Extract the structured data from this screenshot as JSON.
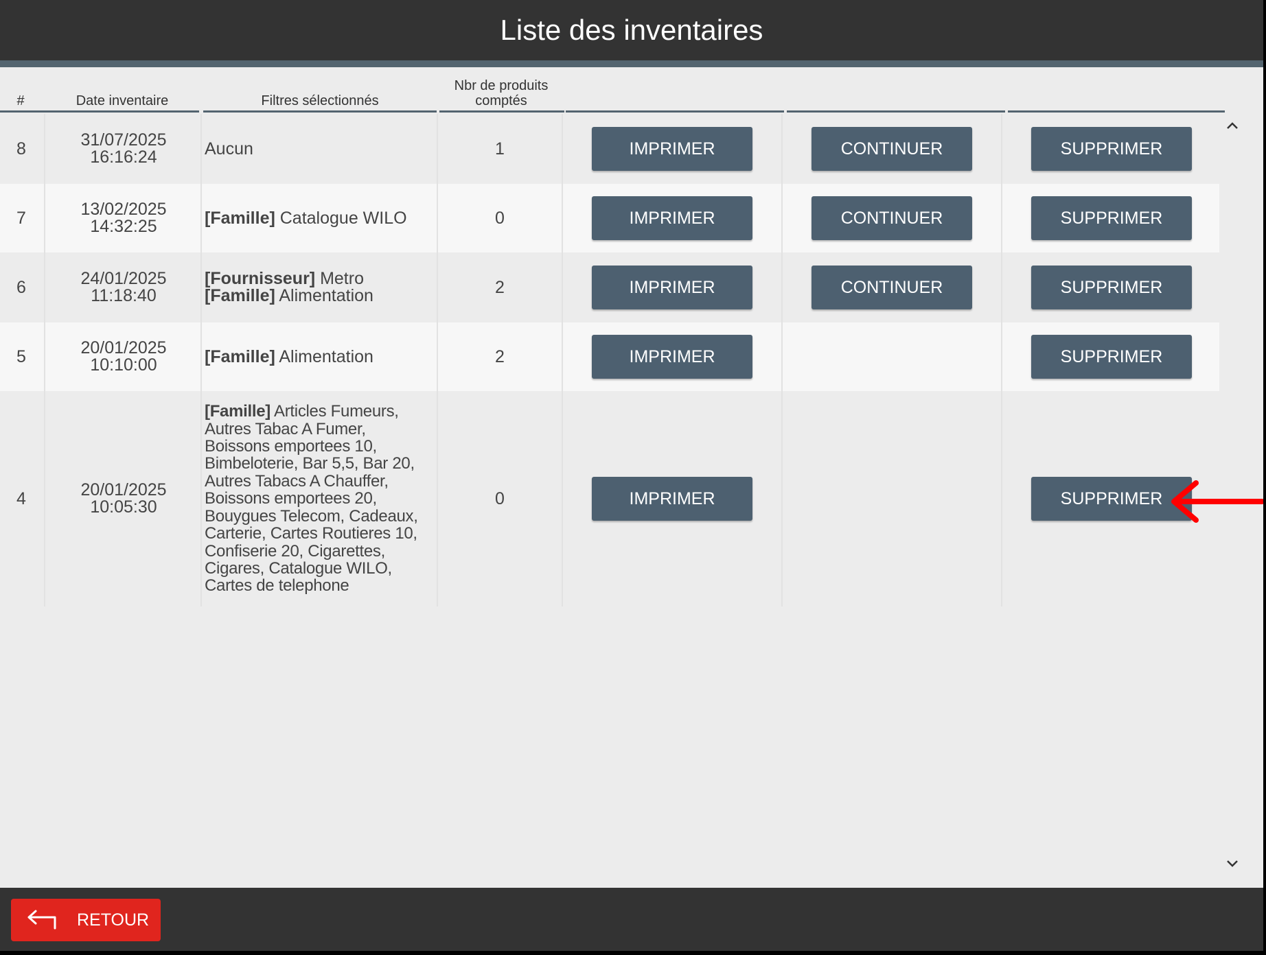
{
  "header": {
    "title": "Liste des inventaires"
  },
  "table": {
    "columns": [
      "#",
      "Date inventaire",
      "Filtres sélectionnés",
      "Nbr de produits comptés"
    ],
    "rows": [
      {
        "num": "8",
        "date": "31/07/2025",
        "time": "16:16:24",
        "filters": [
          {
            "tag": "",
            "text": "Aucun"
          }
        ],
        "count": "1",
        "print": "IMPRIMER",
        "continue": "CONTINUER",
        "delete": "SUPPRIMER"
      },
      {
        "num": "7",
        "date": "13/02/2025",
        "time": "14:32:25",
        "filters": [
          {
            "tag": "[Famille]",
            "text": " Catalogue WILO"
          }
        ],
        "count": "0",
        "print": "IMPRIMER",
        "continue": "CONTINUER",
        "delete": "SUPPRIMER"
      },
      {
        "num": "6",
        "date": "24/01/2025",
        "time": "11:18:40",
        "filters": [
          {
            "tag": "[Fournisseur]",
            "text": " Metro"
          },
          {
            "tag": "[Famille]",
            "text": " Alimentation"
          }
        ],
        "count": "2",
        "print": "IMPRIMER",
        "continue": "CONTINUER",
        "delete": "SUPPRIMER"
      },
      {
        "num": "5",
        "date": "20/01/2025",
        "time": "10:10:00",
        "filters": [
          {
            "tag": "[Famille]",
            "text": " Alimentation"
          }
        ],
        "count": "2",
        "print": "IMPRIMER",
        "continue": "",
        "delete": "SUPPRIMER"
      },
      {
        "num": "4",
        "date": "20/01/2025",
        "time": "10:05:30",
        "filters": [
          {
            "tag": "[Famille]",
            "text": " Articles Fumeurs,"
          }
        ],
        "filter_lines": [
          "Autres Tabac A Fumer,",
          "Boissons emportees 10,",
          "Bimbeloterie, Bar 5,5, Bar 20,",
          "Autres Tabacs A Chauffer,",
          "Boissons emportees 20,",
          "Bouygues Telecom, Cadeaux,",
          "Carterie, Cartes Routieres 10,",
          "Confiserie 20, Cigarettes,",
          "Cigares, Catalogue WILO,",
          "Cartes de telephone"
        ],
        "count": "0",
        "print": "IMPRIMER",
        "continue": "",
        "delete": "SUPPRIMER"
      }
    ]
  },
  "scroll": {
    "up_icon": "chevron-up-icon",
    "down_icon": "chevron-down-icon"
  },
  "footer": {
    "back_label": "RETOUR",
    "back_icon": "return-arrow-icon"
  },
  "colors": {
    "header": "#333333",
    "button": "#4d6070",
    "back_button": "#e0251e",
    "annotation_arrow": "#ff0000"
  }
}
